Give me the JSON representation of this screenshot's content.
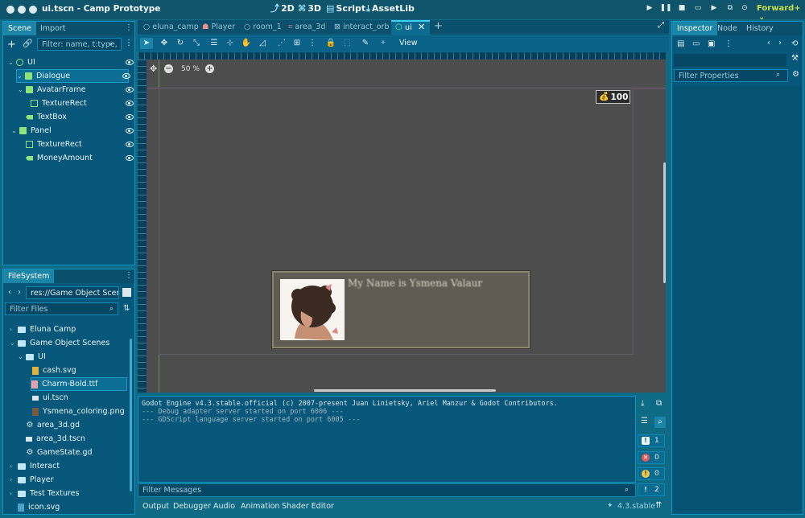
{
  "window": {
    "title": "ui.tscn - Camp Prototype"
  },
  "modes": [
    {
      "icon": "2d-icon",
      "glyph": "⤴",
      "label": "2D"
    },
    {
      "icon": "3d-icon",
      "glyph": "⌘",
      "label": "3D"
    },
    {
      "icon": "script-icon",
      "glyph": "▤",
      "label": "Script"
    },
    {
      "icon": "assetlib-icon",
      "glyph": "⤓",
      "label": "AssetLib"
    }
  ],
  "renderer": "Forward+",
  "scene_dock": {
    "tabs": [
      "Scene",
      "Import"
    ],
    "filter_placeholder": "Filter: name, t:type,",
    "nodes": [
      {
        "label": "UI",
        "kind": "root"
      },
      {
        "label": "Dialogue",
        "kind": "panel"
      },
      {
        "label": "AvatarFrame",
        "kind": "panel"
      },
      {
        "label": "TextureRect",
        "kind": "texture"
      },
      {
        "label": "TextBox",
        "kind": "label"
      },
      {
        "label": "Panel",
        "kind": "panel"
      },
      {
        "label": "TextureRect",
        "kind": "texture"
      },
      {
        "label": "MoneyAmount",
        "kind": "label"
      }
    ]
  },
  "filesystem": {
    "tab": "FileSystem",
    "path": "res://Game Object Scenes/",
    "filter_placeholder": "Filter Files",
    "items": [
      {
        "label": "Eluna Camp",
        "type": "folder"
      },
      {
        "label": "Game Object Scenes",
        "type": "folder"
      },
      {
        "label": "UI",
        "type": "folder"
      },
      {
        "label": "cash.svg",
        "type": "file"
      },
      {
        "label": "Charm-Bold.ttf",
        "type": "file"
      },
      {
        "label": "ui.tscn",
        "type": "file"
      },
      {
        "label": "Ysmena_coloring.png",
        "type": "file"
      },
      {
        "label": "area_3d.gd",
        "type": "gear"
      },
      {
        "label": "area_3d.tscn",
        "type": "file"
      },
      {
        "label": "GameState.gd",
        "type": "gear"
      },
      {
        "label": "Interact",
        "type": "folder"
      },
      {
        "label": "Player",
        "type": "folder"
      },
      {
        "label": "Test Textures",
        "type": "folder"
      },
      {
        "label": "icon.svg",
        "type": "file"
      }
    ]
  },
  "editor_tabs": [
    "eluna_camp",
    "Player",
    "room_1",
    "area_3d",
    "interact_orb",
    "ui"
  ],
  "toolbar": {
    "view_label": "View"
  },
  "viewport": {
    "zoom": "50 %",
    "money": "100",
    "dialogue_text": "My Name is Ysmena Valaur"
  },
  "inspector": {
    "tabs": [
      "Inspector",
      "Node",
      "History"
    ],
    "filter_placeholder": "Filter Properties"
  },
  "output": {
    "lines": [
      "Godot Engine v4.3.stable.official (c) 2007-present Juan Linietsky, Ariel Manzur & Godot Contributors.",
      "--- Debug adapter server started on port 6006 ---",
      "--- GDScript language server started on port 6005 ---"
    ],
    "filter_placeholder": "Filter Messages",
    "counts": {
      "messages": "1",
      "errors": "0",
      "warnings": "0",
      "info": "2"
    }
  },
  "bottom_tabs": [
    "Output",
    "Debugger",
    "Audio",
    "Animation",
    "Shader Editor"
  ],
  "version": "4.3.stable",
  "colors": {
    "accent": "#0b97c4",
    "node_green": "#8ee37a",
    "panel_bg": "#07577a"
  }
}
